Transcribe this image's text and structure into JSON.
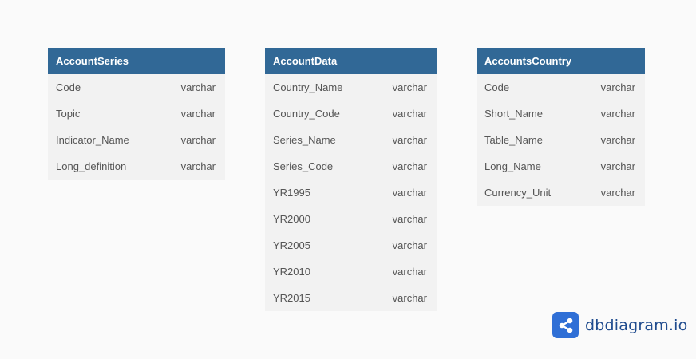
{
  "tables": [
    {
      "name": "AccountSeries",
      "columns": [
        {
          "name": "Code",
          "type": "varchar"
        },
        {
          "name": "Topic",
          "type": "varchar"
        },
        {
          "name": "Indicator_Name",
          "type": "varchar"
        },
        {
          "name": "Long_definition",
          "type": "varchar"
        }
      ]
    },
    {
      "name": "AccountData",
      "columns": [
        {
          "name": "Country_Name",
          "type": "varchar"
        },
        {
          "name": "Country_Code",
          "type": "varchar"
        },
        {
          "name": "Series_Name",
          "type": "varchar"
        },
        {
          "name": "Series_Code",
          "type": "varchar"
        },
        {
          "name": "YR1995",
          "type": "varchar"
        },
        {
          "name": "YR2000",
          "type": "varchar"
        },
        {
          "name": "YR2005",
          "type": "varchar"
        },
        {
          "name": "YR2010",
          "type": "varchar"
        },
        {
          "name": "YR2015",
          "type": "varchar"
        }
      ]
    },
    {
      "name": "AccountsCountry",
      "columns": [
        {
          "name": "Code",
          "type": "varchar"
        },
        {
          "name": "Short_Name",
          "type": "varchar"
        },
        {
          "name": "Table_Name",
          "type": "varchar"
        },
        {
          "name": "Long_Name",
          "type": "varchar"
        },
        {
          "name": "Currency_Unit",
          "type": "varchar"
        }
      ]
    }
  ],
  "branding": {
    "logo_text": "dbdiagram.io",
    "logo_icon": "share-nodes-icon"
  },
  "colors": {
    "header_bg": "#316896",
    "header_text": "#ffffff",
    "row_bg": "#f2f2f2",
    "row_text": "#555555",
    "page_bg": "#fafafa",
    "logo_blue": "#2f6fd6",
    "logo_text": "#1f4b8e"
  }
}
